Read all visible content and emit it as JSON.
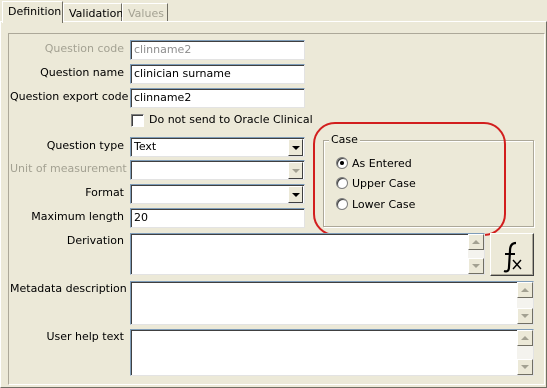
{
  "tabs": [
    {
      "label": "Definition",
      "active": true,
      "enabled": true
    },
    {
      "label": "Validation",
      "active": false,
      "enabled": true
    },
    {
      "label": "Values",
      "active": false,
      "enabled": false
    }
  ],
  "form": {
    "question_code": {
      "label": "Question code",
      "value": "clinname2",
      "enabled": false
    },
    "question_name": {
      "label": "Question name",
      "value": "clinician surname"
    },
    "question_export_code": {
      "label": "Question export code",
      "value": "clinname2"
    },
    "do_not_send": {
      "label": "Do not send to Oracle Clinical",
      "checked": false
    },
    "question_type": {
      "label": "Question type",
      "value": "Text"
    },
    "unit_of_measurement": {
      "label": "Unit of measurement",
      "value": "",
      "enabled": false
    },
    "format": {
      "label": "Format",
      "value": ""
    },
    "maximum_length": {
      "label": "Maximum length",
      "value": "20"
    },
    "derivation": {
      "label": "Derivation",
      "value": ""
    },
    "metadata_description": {
      "label": "Metadata description",
      "value": ""
    },
    "user_help_text": {
      "label": "User help text",
      "value": ""
    }
  },
  "case_group": {
    "title": "Case",
    "options": [
      {
        "label": "As Entered",
        "selected": true
      },
      {
        "label": "Upper Case",
        "selected": false
      },
      {
        "label": "Lower Case",
        "selected": false
      }
    ]
  },
  "icons": {
    "derivation_button": "function-fx-icon"
  },
  "colors": {
    "highlight": "#d21e1e",
    "window_bg": "#ece9d8"
  }
}
